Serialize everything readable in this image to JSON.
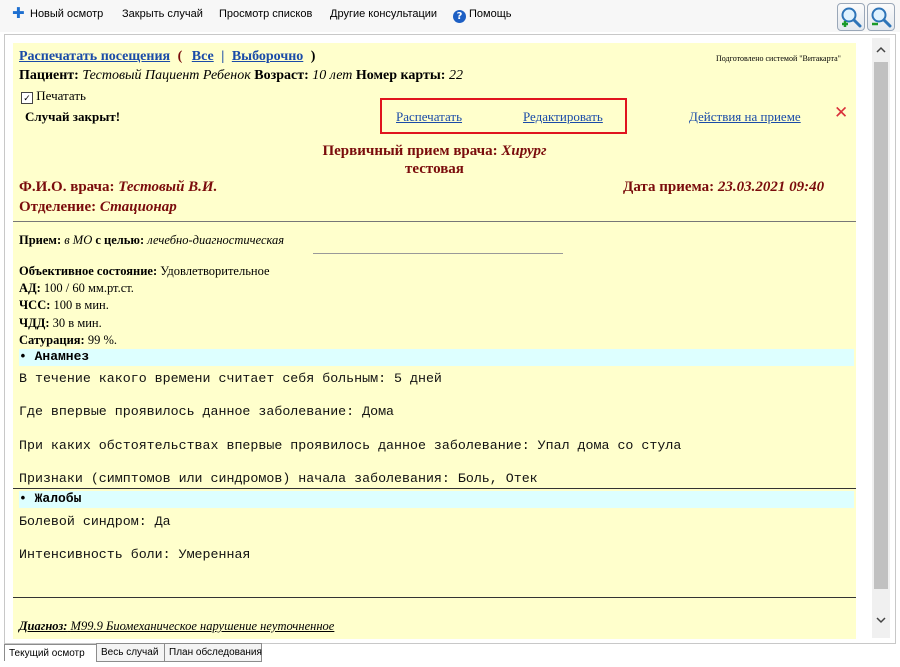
{
  "toolbar": {
    "new_exam": "Новый осмотр",
    "close_case": "Закрыть случай",
    "view_lists": "Просмотр списков",
    "other_consults": "Другие консультации",
    "help": "Помощь"
  },
  "header": {
    "print_visits": "Распечатать посещения",
    "open_paren": "(",
    "all": "Все",
    "sep": "|",
    "selective": "Выборочно",
    "close_paren": ")",
    "prepared_by": "Подготовлено системой \"Витакарта\"",
    "patient_label": "Пациент:",
    "patient_name": "Тестовый Пациент Ребенок",
    "age_label": "Возраст:",
    "age_value": "10 лет",
    "card_label": "Номер карты:",
    "card_value": "22",
    "print_checkbox_label": "Печатать",
    "case_closed": "Случай закрыт!",
    "print_link": "Распечатать",
    "edit_link": "Редактировать",
    "actions_link": "Действия на приеме",
    "delete_symbol": "✕"
  },
  "visit": {
    "title_prefix": "Первичный прием врача:",
    "specialty": "Хирург",
    "subtitle": "тестовая",
    "doctor_label": "Ф.И.О. врача:",
    "doctor_name": "Тестовый В.И.",
    "date_label": "Дата приема:",
    "date_value": "23.03.2021 09:40",
    "dept_label": "Отделение:",
    "dept_value": "Стационар"
  },
  "reception": {
    "label": "Прием:",
    "place": "в МО",
    "purpose_label": "с целью:",
    "purpose_value": "лечебно-диагностическая"
  },
  "vitals": [
    {
      "label": "Объективное состояние:",
      "value": "Удовлетворительное"
    },
    {
      "label": "АД:",
      "value": "100 / 60 мм.рт.ст."
    },
    {
      "label": "ЧСС:",
      "value": "100 в мин."
    },
    {
      "label": "ЧДД:",
      "value": "30 в мин."
    },
    {
      "label": "Сатурация:",
      "value": "99 %."
    }
  ],
  "anamnesis": {
    "title": "• Анамнез",
    "lines": [
      "В течение какого времени считает себя больным: 5 дней",
      "Где впервые проявилось данное заболевание: Дома",
      "При каких обстоятельствах впервые проявилось данное заболевание: Упал дома со стула",
      "Признаки (симптомов или синдромов) начала заболевания: Боль, Отек"
    ]
  },
  "complaints": {
    "title": "• Жалобы",
    "lines": [
      "Болевой синдром: Да",
      "Интенсивность боли: Умеренная"
    ]
  },
  "diagnosis": {
    "label": "Диагноз:",
    "value": "M99.9 Биомеханическое нарушение неуточненное"
  },
  "tabs": [
    "Текущий осмотр",
    "Весь случай",
    "План обследования"
  ],
  "colors": {
    "content_bg": "#ffffcc",
    "link": "#1a4ba8",
    "title_red": "#7a0c0c",
    "highlight_box": "#e0141e",
    "section_bg": "#ddffff"
  }
}
